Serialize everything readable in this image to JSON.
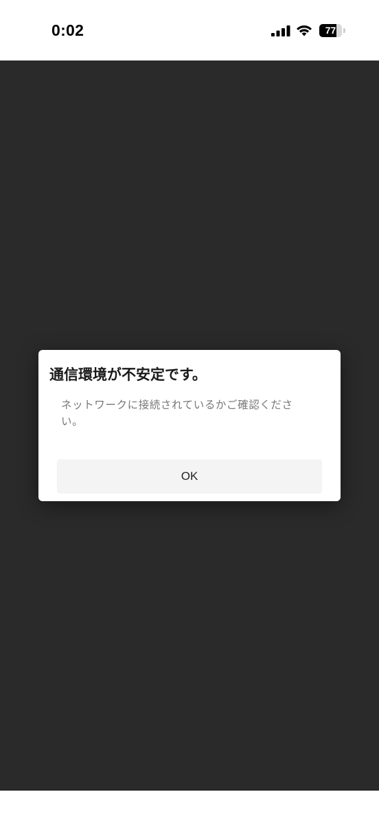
{
  "status_bar": {
    "time": "0:02",
    "battery_level": "77",
    "battery_fraction": 0.77,
    "icons": [
      "signal-icon",
      "wifi-icon",
      "battery-icon"
    ]
  },
  "dialog": {
    "title": "通信環境が不安定です。",
    "message": "ネットワークに接続されているかご確認ください。",
    "ok_label": "OK"
  },
  "colors": {
    "overlay": "#2a2a2a",
    "dialog_bg": "#ffffff",
    "button_bg": "#f4f4f4",
    "title_text": "#1a1a1a",
    "message_text": "#777777"
  }
}
